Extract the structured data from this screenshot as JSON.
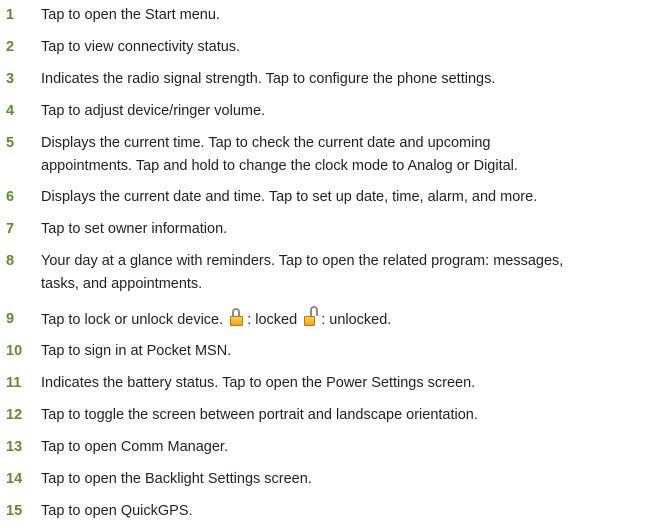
{
  "items": [
    {
      "num": "1",
      "text": "Tap to open the Start menu."
    },
    {
      "num": "2",
      "text": "Tap to view connectivity status."
    },
    {
      "num": "3",
      "text": "Indicates the radio signal strength. Tap to configure the phone settings."
    },
    {
      "num": "4",
      "text": "Tap to adjust device/ringer volume."
    },
    {
      "num": "5",
      "line1": "Displays the current time. Tap to check the current date and upcoming",
      "line2": "appointments. Tap and hold to change the clock mode to Analog or Digital."
    },
    {
      "num": "6",
      "text": "Displays the current date and time. Tap to set up date, time, alarm, and more."
    },
    {
      "num": "7",
      "text": "Tap to set owner information."
    },
    {
      "num": "8",
      "line1": "Your day at a glance with reminders. Tap to open the related program: messages,",
      "line2": "tasks, and appointments."
    },
    {
      "num": "9",
      "text_a": "Tap to lock or unlock device.",
      "text_b": ": locked",
      "text_c": ": unlocked.",
      "icon_locked": "locked-padlock-icon",
      "icon_unlocked": "unlocked-padlock-icon"
    },
    {
      "num": "10",
      "text": "Tap to sign in at Pocket MSN."
    },
    {
      "num": "11",
      "text": "Indicates the battery status. Tap to open the Power Settings screen."
    },
    {
      "num": "12",
      "text": "Tap to toggle the screen between portrait and landscape orientation."
    },
    {
      "num": "13",
      "text": "Tap to open Comm Manager."
    },
    {
      "num": "14",
      "text": "Tap to open the Backlight Settings screen."
    },
    {
      "num": "15",
      "text": "Tap to open QuickGPS."
    }
  ],
  "colors": {
    "number": "#5c8f2a",
    "text": "#231f20"
  }
}
